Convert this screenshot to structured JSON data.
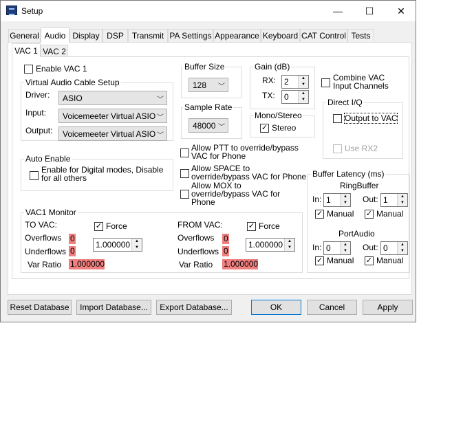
{
  "window": {
    "title": "Setup",
    "minimize": "—",
    "maximize": "☐",
    "close": "✕"
  },
  "tabs": [
    "General",
    "Audio",
    "Display",
    "DSP",
    "Transmit",
    "PA Settings",
    "Appearance",
    "Keyboard",
    "CAT Control",
    "Tests"
  ],
  "subtabs": [
    "VAC 1",
    "VAC 2"
  ],
  "vac": {
    "enable_label": "Enable VAC 1",
    "cable_setup": {
      "title": "Virtual Audio Cable Setup",
      "driver_label": "Driver:",
      "driver_value": "ASIO",
      "input_label": "Input:",
      "input_value": "Voicemeeter Virtual ASIO",
      "output_label": "Output:",
      "output_value": "Voicemeeter Virtual ASIO"
    },
    "auto_enable": {
      "title": "Auto Enable",
      "label": "Enable for Digital modes, Disable for all others"
    },
    "buffer_size": {
      "title": "Buffer Size",
      "value": "128"
    },
    "sample_rate": {
      "title": "Sample Rate",
      "value": "48000"
    },
    "gain": {
      "title": "Gain (dB)",
      "rx_label": "RX:",
      "rx_value": "2",
      "tx_label": "TX:",
      "tx_value": "0"
    },
    "mono_stereo": {
      "title": "Mono/Stereo",
      "stereo_label": "Stereo"
    },
    "combine_label": "Combine VAC Input Channels",
    "direct_iq": {
      "title": "Direct I/Q",
      "output_label": "Output to VAC",
      "use_rx2_label": "Use RX2"
    },
    "allow_ptt": "Allow PTT to override/bypass VAC for Phone",
    "allow_space": "Allow SPACE to override/bypass VAC for Phone",
    "allow_mox": "Allow MOX to override/bypass VAC for Phone",
    "monitor": {
      "title": "VAC1 Monitor",
      "to_vac": "TO VAC:",
      "from_vac": "FROM VAC:",
      "force": "Force",
      "overflows": "Overflows",
      "underflows": "Underflows",
      "var_ratio": "Var Ratio",
      "to": {
        "overflows": "0",
        "underflows": "0",
        "ratio": "1.000000",
        "spin": "1.000000"
      },
      "from": {
        "overflows": "0",
        "underflows": "0",
        "ratio": "1.000000",
        "spin": "1.000000"
      }
    },
    "latency": {
      "title": "Buffer Latency (ms)",
      "ringbuffer": "RingBuffer",
      "portaudio": "PortAudio",
      "in_label": "In:",
      "out_label": "Out:",
      "manual": "Manual",
      "rb_in": "1",
      "rb_out": "1",
      "pa_in": "0",
      "pa_out": "0"
    }
  },
  "footer": {
    "reset": "Reset Database",
    "import": "Import Database...",
    "export": "Export Database...",
    "ok": "OK",
    "cancel": "Cancel",
    "apply": "Apply"
  },
  "check": "✓"
}
